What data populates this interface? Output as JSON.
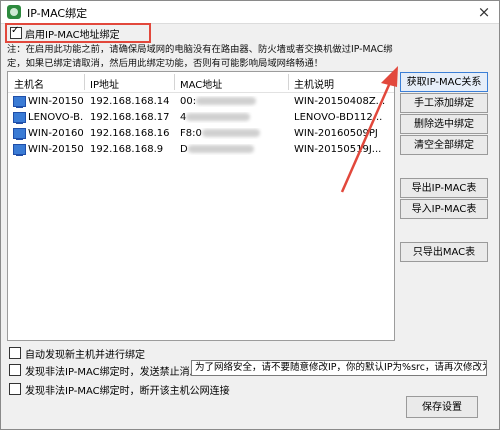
{
  "window": {
    "title": "IP-MAC绑定",
    "close_glyph": "×"
  },
  "enable_binding": {
    "label": "启用IP-MAC地址绑定",
    "checked": true
  },
  "note": {
    "line1": "注：在启用此功能之前，请确保局域网的电脑没有在路由器、防火墙或者交换机做过IP-MAC绑",
    "line2": "定，如果已绑定请取消，然后用此绑定功能，否则有可能影响局域网络畅通！"
  },
  "table": {
    "columns": [
      "主机名",
      "IP地址",
      "MAC地址",
      "主机说明"
    ],
    "rows": [
      {
        "host": "WIN-20150...",
        "ip": "192.168.168.14",
        "mac_visible": "00:",
        "desc": "WIN-20150408Z..."
      },
      {
        "host": "LENOVO-B...",
        "ip": "192.168.168.17",
        "mac_visible": "4",
        "desc": "LENOVO-BD112..."
      },
      {
        "host": "WIN-20160...",
        "ip": "192.168.168.16",
        "mac_visible": "F8:0",
        "desc": "WIN-20160509PJ"
      },
      {
        "host": "WIN-20150...",
        "ip": "192.168.168.9",
        "mac_visible": "D",
        "desc": "WIN-20150519J..."
      }
    ]
  },
  "buttons": {
    "get_ip_mac": "获取IP-MAC关系",
    "manual_add": "手工添加绑定",
    "delete_selected": "删除选中绑定",
    "clear_all": "清空全部绑定",
    "export_table": "导出IP-MAC表",
    "import_table": "导入IP-MAC表",
    "export_mac_only": "只导出MAC表",
    "save": "保存设置"
  },
  "options": {
    "auto_discover": {
      "label": "自动发现新主机并进行绑定",
      "checked": false
    },
    "send_block_msg": {
      "label": "发现非法IP-MAC绑定时，发送禁止消息",
      "checked": false
    },
    "disconnect": {
      "label": "发现非法IP-MAC绑定时，断开该主机公网连接",
      "checked": false
    }
  },
  "block_message": {
    "value": "为了网络安全，请不要随意修改IP，你的默认IP为%src，请再次修改为默"
  },
  "colors": {
    "highlight": "#e2483c",
    "accent": "#3c7fd6"
  },
  "icons": {
    "app": "app-icon",
    "host": "computer-icon",
    "annotation": "red-arrow"
  }
}
